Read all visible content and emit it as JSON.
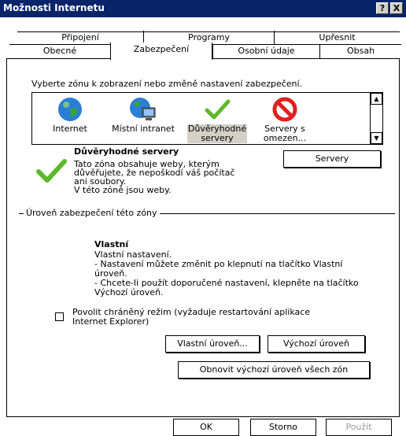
{
  "window": {
    "title": "Možnosti Internetu",
    "help_label": "?",
    "close_label": "X"
  },
  "tabs_back": [
    "Připojení",
    "Programy",
    "Upřesnit"
  ],
  "tabs_front": [
    "Obecné",
    "Zabezpečení",
    "Osobní údaje",
    "Obsah"
  ],
  "active_tab": "Zabezpečení",
  "zones_prompt": "Vyberte zónu k zobrazení nebo změně nastavení zabezpečení.",
  "zones": [
    {
      "label": "Internet",
      "icon": "globe-icon"
    },
    {
      "label": "Místní intranet",
      "icon": "intranet-icon"
    },
    {
      "label_line1": "Důvěryhodné",
      "label_line2": "servery",
      "icon": "checkmark-icon",
      "selected": true
    },
    {
      "label_line1": "Servery s",
      "label_line2": "omezen...",
      "icon": "restricted-icon"
    }
  ],
  "zone_info": {
    "title": "Důvěryhodné servery",
    "description": [
      "Tato zóna obsahuje weby, kterým",
      "důvěřujete, že nepoškodí váš počítač",
      "ani soubory.",
      "V této zóně jsou weby."
    ],
    "servers_button": "Servery"
  },
  "security_level": {
    "group_label": "Úroveň zabezpečení této zóny",
    "level_name": "Vlastní",
    "lines": [
      "Vlastní nastavení.",
      "- Nastavení můžete změnit po klepnutí na tlačítko Vlastní",
      "úroveň.",
      "- Chcete-li použít doporučené nastavení, klepněte na tlačítko",
      "Výchozí úroveň."
    ],
    "protected_mode_line1": "Povolit chráněný režim (vyžaduje restartování aplikace",
    "protected_mode_line2": "Internet Explorer)",
    "protected_mode_checked": false,
    "custom_level_button": "Vlastní úroveň...",
    "default_level_button": "Výchozí úroveň",
    "reset_all_button": "Obnovit výchozí úroveň všech zón"
  },
  "footer": {
    "ok": "OK",
    "cancel": "Storno",
    "apply": "Použít"
  },
  "colors": {
    "titlebar": "#0a246a",
    "selection": "#d4d0c8",
    "check_green": "#5cb82a",
    "restricted_red": "#e02020"
  }
}
